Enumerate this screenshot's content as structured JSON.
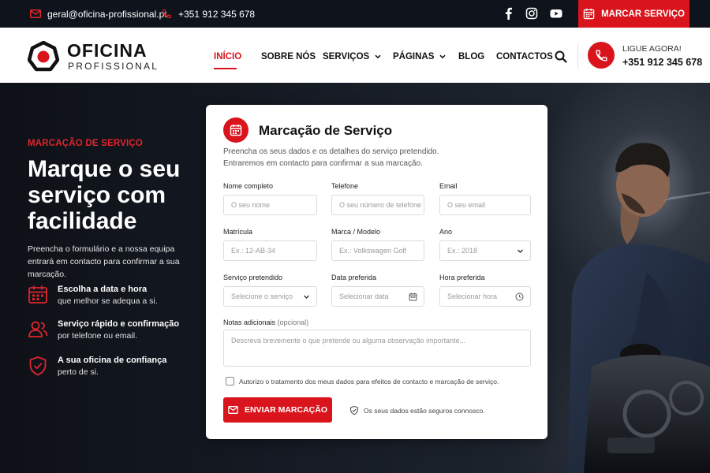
{
  "topbar": {
    "email": "geral@oficina-profissional.pt",
    "phone": "+351 912 345 678",
    "cta_label": "MARCAR SERVIÇO",
    "social": [
      "facebook-icon",
      "instagram-icon",
      "youtube-icon"
    ]
  },
  "brand": {
    "name": "OFICINA",
    "tagline": "PROFISSIONAL",
    "accent_color": "#d9141c"
  },
  "nav": {
    "items": [
      {
        "label": "INÍCIO",
        "active": true
      },
      {
        "label": "SOBRE NÓS"
      },
      {
        "label": "SERVIÇOS",
        "dropdown": true
      },
      {
        "label": "PÁGINAS",
        "dropdown": true
      },
      {
        "label": "BLOG"
      },
      {
        "label": "CONTACTOS"
      }
    ]
  },
  "header_call": {
    "label": "LIGUE AGORA!",
    "number": "+351 912 345 678"
  },
  "hero": {
    "eyebrow": "MARCAÇÃO DE SERVIÇO",
    "title": "Marque o seu serviço com facilidade",
    "text": "Preencha o formulário e a nossa equipa entrará em contacto para confirmar a sua marcação.",
    "features": [
      {
        "icon": "calendar-icon",
        "title": "Escolha a data e hora",
        "sub": "que melhor se adequa a si."
      },
      {
        "icon": "users-icon",
        "title": "Serviço rápido e confirmação",
        "sub": "por telefone ou email."
      },
      {
        "icon": "shield-check-icon",
        "title": "A sua oficina de confiança",
        "sub": "perto de si."
      }
    ]
  },
  "form": {
    "title": "Marcação de Serviço",
    "desc_line1": "Preencha os seus dados e os detalhes do serviço pretendido.",
    "desc_line2": "Entraremos em contacto para confirmar a sua marcação.",
    "fields": {
      "name": {
        "label": "Nome completo",
        "placeholder": "O seu nome"
      },
      "phone": {
        "label": "Telefone",
        "placeholder": "O seu número de telefone"
      },
      "email": {
        "label": "Email",
        "placeholder": "O seu email"
      },
      "plate": {
        "label": "Matrícula",
        "placeholder": "Ex.: 12-AB-34"
      },
      "model": {
        "label": "Marca / Modelo",
        "placeholder": "Ex.: Volkswagen Golf"
      },
      "year": {
        "label": "Ano",
        "placeholder": "Ex.: 2018"
      },
      "service": {
        "label": "Serviço pretendido",
        "placeholder": "Selecione o serviço"
      },
      "date": {
        "label": "Data preferida",
        "placeholder": "Selecionar data"
      },
      "time": {
        "label": "Hora preferida",
        "placeholder": "Selecionar hora"
      },
      "notes": {
        "label": "Notas adicionais",
        "optional": "(opcional)",
        "placeholder": "Descreva brevemente o que pretende ou alguma observação importante..."
      }
    },
    "consent": "Autorizo o tratamento dos meus dados para efeitos de contacto e marcação de serviço.",
    "submit": "ENVIAR MARCAÇÃO",
    "secure_note": "Os seus dados estão seguros connosco."
  }
}
